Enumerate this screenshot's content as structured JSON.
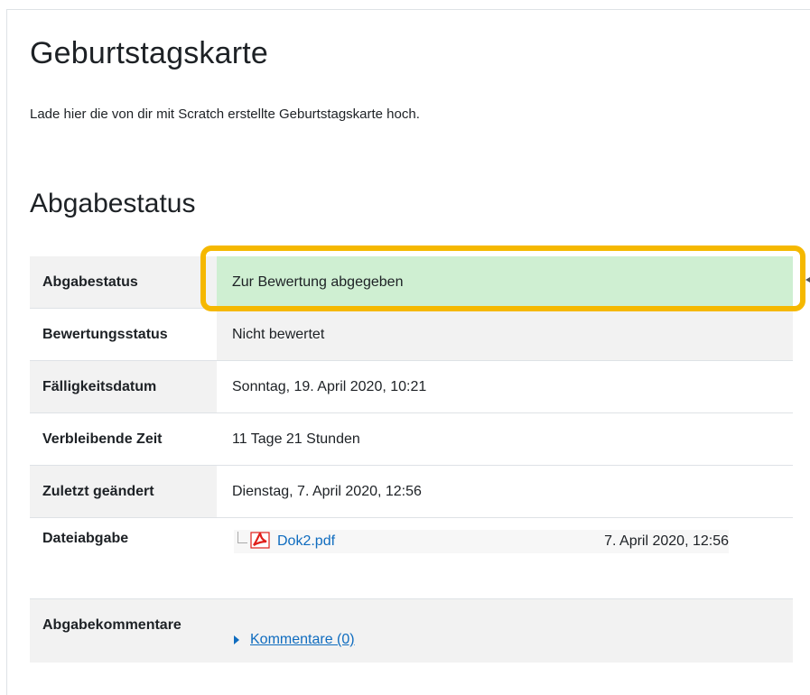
{
  "page": {
    "title": "Geburtstagskarte",
    "intro": "Lade hier die von dir mit Scratch erstellte Geburtstagskarte hoch.",
    "section_title": "Abgabestatus"
  },
  "status": {
    "submission_label": "Abgabestatus",
    "submission_value": "Zur Bewertung abgegeben",
    "grading_label": "Bewertungsstatus",
    "grading_value": "Nicht bewertet",
    "due_label": "Fälligkeitsdatum",
    "due_value": "Sonntag, 19. April 2020, 10:21",
    "remaining_label": "Verbleibende Zeit",
    "remaining_value": "11 Tage 21 Stunden",
    "modified_label": "Zuletzt geändert",
    "modified_value": "Dienstag, 7. April 2020, 12:56",
    "file_label": "Dateiabgabe",
    "file_name": "Dok2.pdf",
    "file_date": "7. April 2020, 12:56",
    "comments_label": "Abgabekommentare",
    "comments_link": "Kommentare (0)"
  },
  "colors": {
    "submitted_bg": "#cfefd2",
    "highlight_border": "#f5b800",
    "link": "#0f6cbf",
    "row_alt": "#f2f2f2"
  },
  "icons": {
    "file": "pdf-icon",
    "comments": "caret-right-icon"
  }
}
